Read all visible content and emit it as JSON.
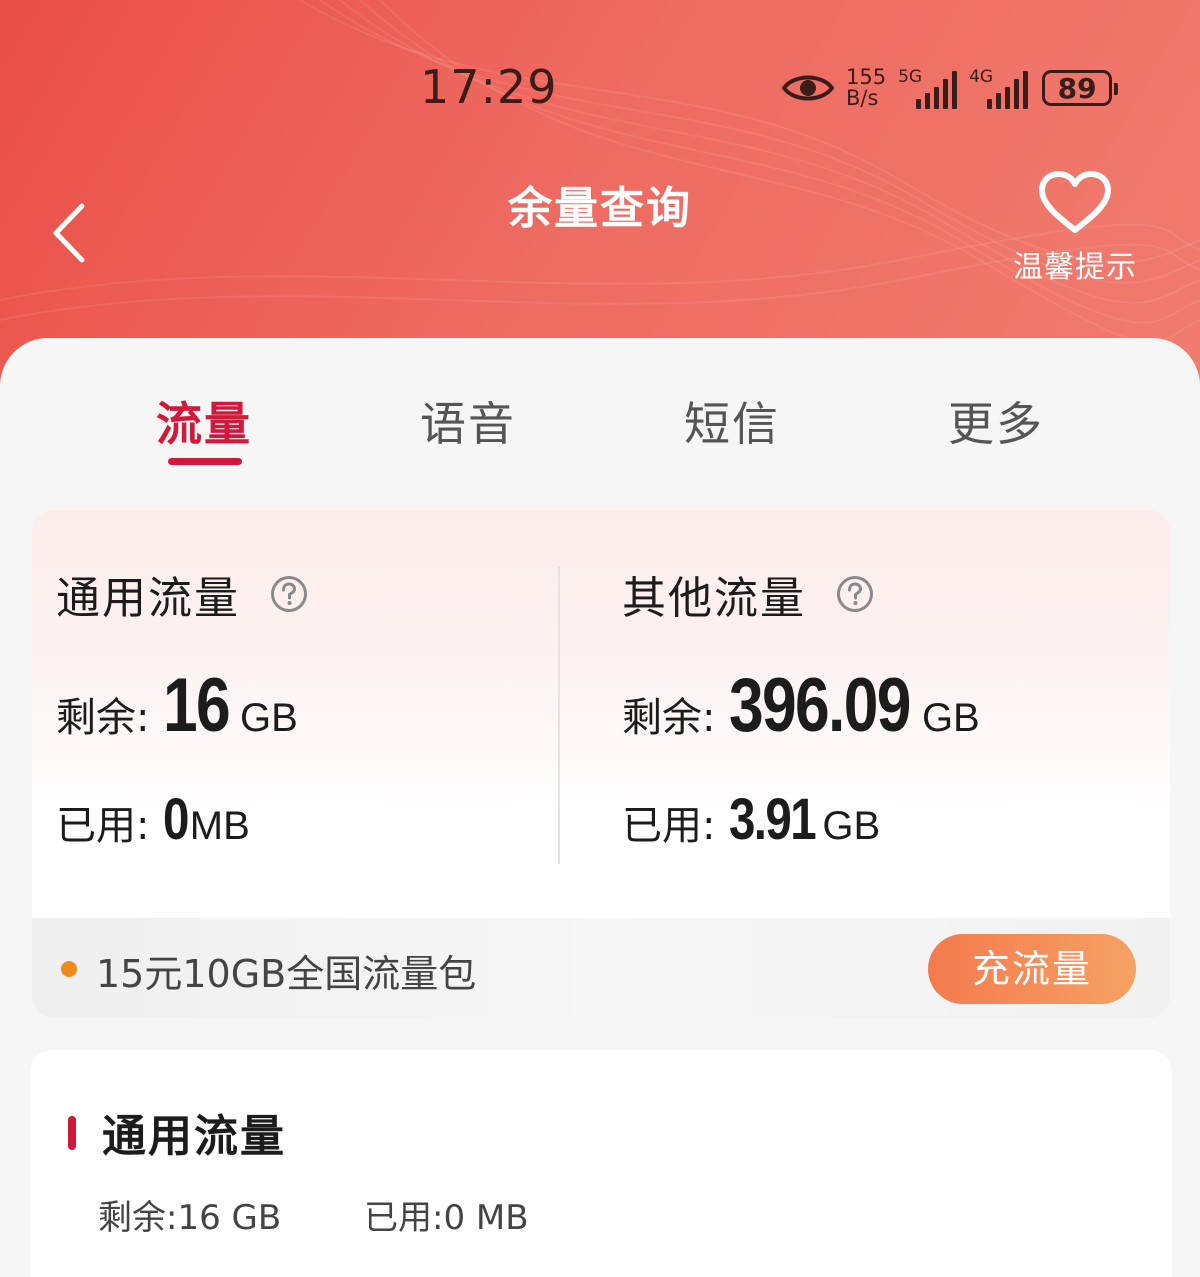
{
  "status_bar": {
    "time": "17:29",
    "net_speed_value": "155",
    "net_speed_unit": "B/s",
    "signal_1_label": "5G",
    "signal_2_label": "4G",
    "battery_level": "89"
  },
  "header": {
    "title": "余量查询",
    "tips_label": "温馨提示"
  },
  "tabs": [
    {
      "label": "流量",
      "active": true
    },
    {
      "label": "语音",
      "active": false
    },
    {
      "label": "短信",
      "active": false
    },
    {
      "label": "更多",
      "active": false
    }
  ],
  "summary": {
    "general": {
      "title": "通用流量",
      "remaining_label": "剩余:",
      "remaining_value": "16",
      "remaining_unit": "GB",
      "used_label": "已用:",
      "used_value": "0",
      "used_unit": "MB"
    },
    "other": {
      "title": "其他流量",
      "remaining_label": "剩余:",
      "remaining_value": "396.09",
      "remaining_unit": "GB",
      "used_label": "已用:",
      "used_value": "3.91",
      "used_unit": "GB"
    },
    "promo_text": "15元10GB全国流量包",
    "recharge_label": "充流量"
  },
  "detail": {
    "title": "通用流量",
    "remaining": "剩余:16 GB",
    "used": "已用:0 MB"
  },
  "colors": {
    "header_red": "#ea4f48",
    "accent_red": "#d2193b",
    "promo_dot": "#f08a1c",
    "recharge_orange": "#f47a4e"
  },
  "icons": {
    "back": "chevron-left-icon",
    "tips": "heart-icon",
    "help": "question-circle-icon",
    "eye": "eye-icon"
  }
}
